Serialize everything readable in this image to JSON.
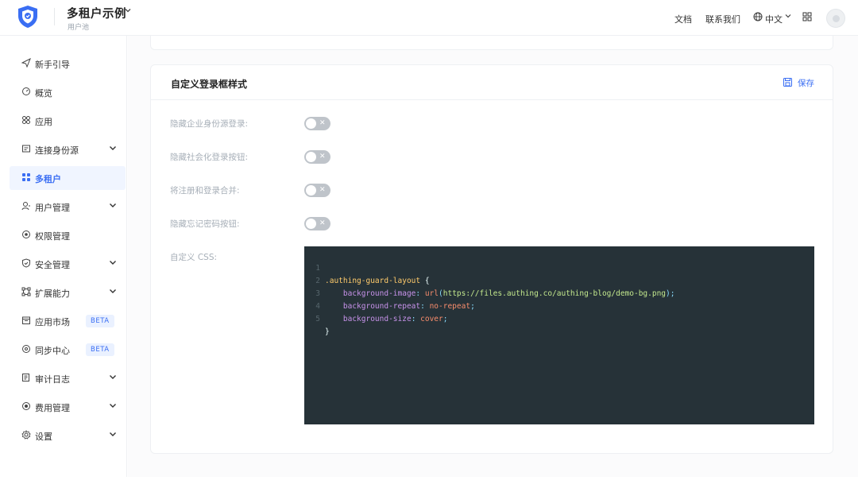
{
  "header": {
    "app_title": "多租户示例",
    "app_subtitle": "用户池",
    "links": {
      "docs": "文档",
      "contact": "联系我们",
      "language": "中文"
    },
    "icons": {
      "logo": "shield-logo-icon",
      "language": "globe-icon",
      "apps": "apps-grid-icon"
    }
  },
  "sidebar": {
    "items": [
      {
        "label": "新手引导",
        "icon": "send-icon"
      },
      {
        "label": "概览",
        "icon": "dashboard-icon"
      },
      {
        "label": "应用",
        "icon": "apps-icon"
      },
      {
        "label": "连接身份源",
        "icon": "connection-icon",
        "expandable": true
      },
      {
        "label": "多租户",
        "icon": "tenant-grid-icon",
        "active": true
      },
      {
        "label": "用户管理",
        "icon": "users-icon",
        "expandable": true
      },
      {
        "label": "权限管理",
        "icon": "permission-icon"
      },
      {
        "label": "安全管理",
        "icon": "security-shield-icon",
        "expandable": true
      },
      {
        "label": "扩展能力",
        "icon": "extension-icon",
        "expandable": true
      },
      {
        "label": "应用市场",
        "icon": "market-icon",
        "badge": "BETA"
      },
      {
        "label": "同步中心",
        "icon": "sync-icon",
        "badge": "BETA"
      },
      {
        "label": "审计日志",
        "icon": "audit-log-icon",
        "expandable": true
      },
      {
        "label": "费用管理",
        "icon": "billing-icon",
        "expandable": true
      },
      {
        "label": "设置",
        "icon": "settings-icon",
        "expandable": true
      }
    ]
  },
  "card": {
    "title": "自定义登录框样式",
    "save_label": "保存",
    "fields": [
      {
        "label": "隐藏企业身份源登录:",
        "enabled": false
      },
      {
        "label": "隐藏社会化登录按钮:",
        "enabled": false
      },
      {
        "label": "将注册和登录合并:",
        "enabled": false
      },
      {
        "label": "隐藏忘记密码按钮:",
        "enabled": false
      }
    ],
    "css_label": "自定义 CSS:",
    "code_lines": [
      {
        "n": "1",
        "text": ".authing-guard-layout {"
      },
      {
        "n": "2",
        "text": "    background-image: url(https://files.authing.co/authing-blog/demo-bg.png);"
      },
      {
        "n": "3",
        "text": "    background-repeat: no-repeat;"
      },
      {
        "n": "4",
        "text": "    background-size: cover;"
      },
      {
        "n": "5",
        "text": "}"
      }
    ],
    "code_tokens": {
      "selector": ".authing-guard-layout",
      "prop1": "background-image",
      "fn1": "url",
      "url": "https://files.authing.co/authing-blog/demo-bg.png",
      "prop2": "background-repeat",
      "val2": "no-repeat",
      "prop3": "background-size",
      "val3": "cover"
    }
  },
  "colors": {
    "accent": "#3a6ef3",
    "editor_bg": "#263238",
    "toggle_off": "#bfc4ca"
  }
}
